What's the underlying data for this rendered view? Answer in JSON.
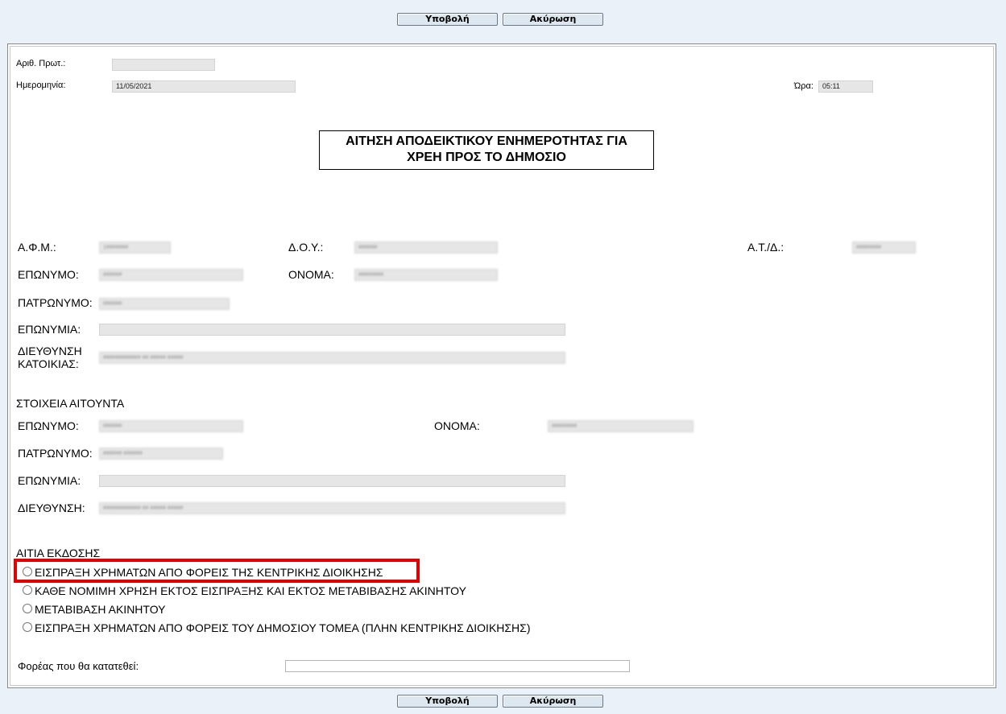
{
  "buttons": {
    "submit": "Υποβολή",
    "cancel": "Ακύρωση"
  },
  "header": {
    "protocol_label": "Αριθ. Πρωτ.:",
    "protocol_value": "",
    "date_label": "Ημερομηνία:",
    "date_value": "11/05/2021",
    "time_label": "Ώρα:",
    "time_value": "05:11"
  },
  "title": {
    "line1": "ΑΙΤΗΣΗ ΑΠΟΔΕΙΚΤΙΚΟΥ ΕΝΗΜΕΡΟΤΗΤΑΣ ΓΙΑ",
    "line2": "ΧΡΕΗ ΠΡΟΣ ΤΟ ΔΗΜΟΣΙΟ"
  },
  "taxpayer": {
    "afm_label": "Α.Φ.Μ.:",
    "afm_value": "1#######",
    "doy_label": "Δ.Ο.Υ.:",
    "doy_value": "######",
    "at_label": "Α.Τ./Δ.:",
    "at_value": "########",
    "surname_label": "ΕΠΩΝΥΜΟ:",
    "surname_value": "######",
    "name_label": "ΟΝΟΜΑ:",
    "name_value": "########",
    "father_label": "ΠΑΤΡΩΝΥΜΟ:",
    "father_value": "######",
    "company_label": "ΕΠΩΝΥΜΙΑ:",
    "company_value": "",
    "address_label_1": "ΔΙΕΥΘΥΝΣΗ",
    "address_label_2": "ΚΑΤΟΙΚΙΑΣ:",
    "address_value": "############ ## ##### #####"
  },
  "applicant": {
    "section_label": "ΣΤΟΙΧΕΙΑ ΑΙΤΟΥΝΤΑ",
    "surname_label": "ΕΠΩΝΥΜΟ:",
    "surname_value": "######",
    "name_label": "ΟΝΟΜΑ:",
    "name_value": "########",
    "father_label": "ΠΑΤΡΩΝΥΜΟ:",
    "father_value": "###### ######",
    "company_label": "ΕΠΩΝΥΜΙΑ:",
    "company_value": "",
    "address_label": "ΔΙΕΥΘΥΝΣΗ:",
    "address_value": "############ ## ##### #####"
  },
  "reason": {
    "label": "ΑΙΤΙΑ ΕΚΔΟΣΗΣ",
    "options": [
      "ΕΙΣΠΡΑΞΗ ΧΡΗΜΑΤΩΝ ΑΠΟ ΦΟΡΕΙΣ ΤΗΣ ΚΕΝΤΡΙΚΗΣ ΔΙΟΙΚΗΣΗΣ",
      "ΚΑΘΕ ΝΟΜΙΜΗ ΧΡΗΣΗ ΕΚΤΟΣ ΕΙΣΠΡΑΞΗΣ ΚΑΙ ΕΚΤΟΣ ΜΕΤΑΒΙΒΑΣΗΣ ΑΚΙΝΗΤΟΥ",
      "ΜΕΤΑΒΙΒΑΣΗ ΑΚΙΝΗΤΟΥ",
      "ΕΙΣΠΡΑΞΗ ΧΡΗΜΑΤΩΝ ΑΠΟ ΦΟΡΕΙΣ ΤΟΥ ΔΗΜΟΣΙΟΥ ΤΟΜΕΑ (ΠΛΗΝ ΚΕΝΤΡΙΚΗΣ ΔΙΟΙΚΗΣΗΣ)"
    ],
    "highlight_color": "#e00000"
  },
  "agency": {
    "label": "Φορέας που θα κατατεθεί:",
    "value": ""
  }
}
